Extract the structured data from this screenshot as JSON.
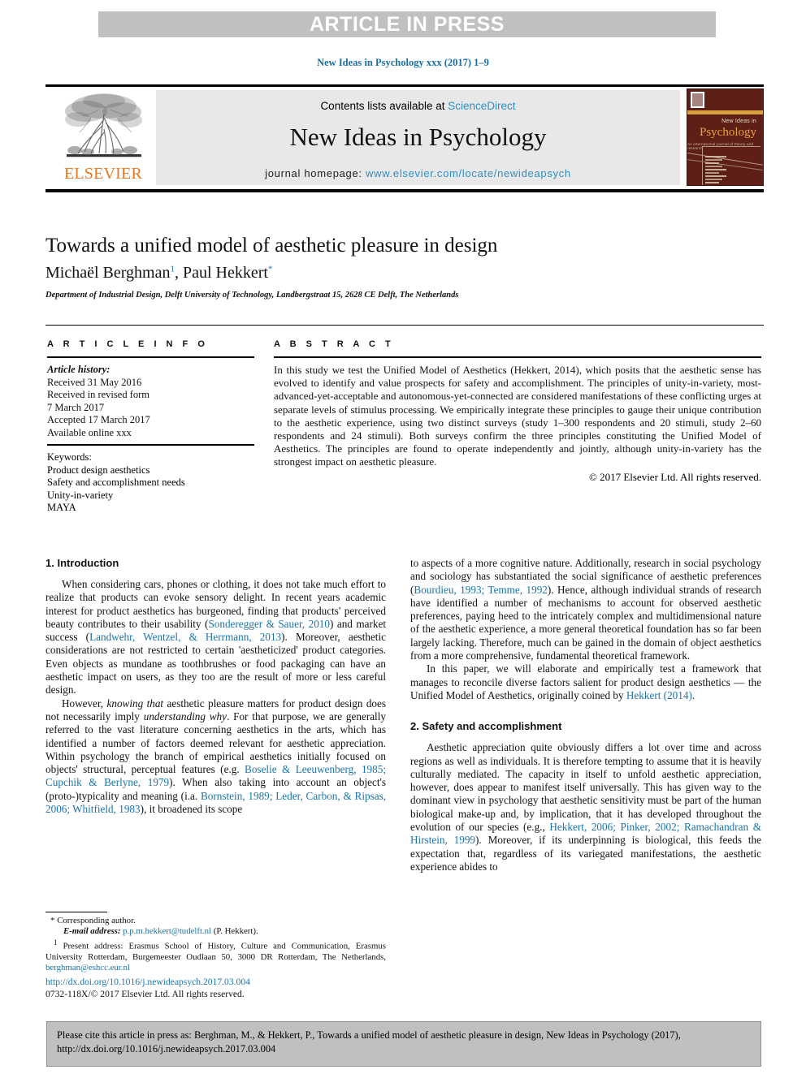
{
  "banner": {
    "label": "ARTICLE IN PRESS"
  },
  "running_head": {
    "text": "New Ideas in Psychology xxx (2017) 1–9"
  },
  "masthead": {
    "publisher_wordmark": "ELSEVIER",
    "contents_prefix": "Contents lists available at ",
    "contents_link": "ScienceDirect",
    "journal_name": "New Ideas in Psychology",
    "homepage_label": "journal homepage: ",
    "homepage_url": "www.elsevier.com/locate/newideapsych",
    "cover": {
      "line1": "New Ideas in",
      "line2": "Psychology",
      "line3": "An international journal of theory and research"
    }
  },
  "article": {
    "title": "Towards a unified model of aesthetic pleasure in design",
    "author1": "Michaël Berghman",
    "author1_sup": "1",
    "author_sep": ", ",
    "author2": "Paul Hekkert",
    "author2_sup": "*",
    "affiliation": "Department of Industrial Design, Delft University of Technology, Landbergstraat 15, 2628 CE Delft, The Netherlands"
  },
  "article_info": {
    "heading": "A R T I C L E   I N F O",
    "history_label": "Article history:",
    "history": [
      "Received 31 May 2016",
      "Received in revised form",
      "7 March 2017",
      "Accepted 17 March 2017",
      "Available online xxx"
    ],
    "keywords_label": "Keywords:",
    "keywords": [
      "Product design aesthetics",
      "Safety and accomplishment needs",
      "Unity-in-variety",
      "MAYA"
    ]
  },
  "abstract": {
    "heading": "A B S T R A C T",
    "text": "In this study we test the Unified Model of Aesthetics (Hekkert, 2014), which posits that the aesthetic sense has evolved to identify and value prospects for safety and accomplishment. The principles of unity-in-variety, most-advanced-yet-acceptable and autonomous-yet-connected are considered manifestations of these conflicting urges at separate levels of stimulus processing. We empirically integrate these principles to gauge their unique contribution to the aesthetic experience, using two distinct surveys (study 1–300 respondents and 20 stimuli, study 2–60 respondents and 24 stimuli). Both surveys confirm the three principles constituting the Unified Model of Aesthetics. The principles are found to operate independently and jointly, although unity-in-variety has the strongest impact on aesthetic pleasure.",
    "copyright": "© 2017 Elsevier Ltd. All rights reserved."
  },
  "sections": {
    "introduction_heading": "1. Introduction",
    "safety_heading": "2. Safety and accomplishment"
  },
  "body": {
    "left_p1_a": "When considering cars, phones or clothing, it does not take much effort to realize that products can evoke sensory delight. In recent years academic interest for product aesthetics has burgeoned, finding that products' perceived beauty contributes to their usability (",
    "left_p1_ref1": "Sonderegger & Sauer, 2010",
    "left_p1_b": ") and market success (",
    "left_p1_ref2": "Landwehr, Wentzel, & Herrmann, 2013",
    "left_p1_c": "). Moreover, aesthetic considerations are not restricted to certain 'aestheticized' product categories. Even objects as mundane as toothbrushes or food packaging can have an aesthetic impact on users, as they too are the result of more or less careful design.",
    "left_p2_a": "However, ",
    "left_p2_em1": "knowing that",
    "left_p2_b": " aesthetic pleasure matters for product design does not necessarily imply ",
    "left_p2_em2": "understanding why",
    "left_p2_c": ". For that purpose, we are generally referred to the vast literature concerning aesthetics in the arts, which has identified a number of factors deemed relevant for aesthetic appreciation. Within psychology the branch of empirical aesthetics initially focused on objects' structural, perceptual features (e.g. ",
    "left_p2_ref1": "Boselie & Leeuwenberg, 1985; Cupchik & Berlyne, 1979",
    "left_p2_d": "). When also taking into account an object's (proto-)typicality and meaning (i.a. ",
    "left_p2_ref2": "Bornstein, 1989; Leder, Carbon, & Ripsas, 2006; Whitfield, 1983",
    "left_p2_e": "), it broadened its scope",
    "right_p1_a": "to aspects of a more cognitive nature. Additionally, research in social psychology and sociology has substantiated the social significance of aesthetic preferences (",
    "right_p1_ref1": "Bourdieu, 1993; Temme, 1992",
    "right_p1_b": "). Hence, although individual strands of research have identified a number of mechanisms to account for observed aesthetic preferences, paying heed to the intricately complex and multidimensional nature of the aesthetic experience, a more general theoretical foundation has so far been largely lacking. Therefore, much can be gained in the domain of object aesthetics from a more comprehensive, fundamental theoretical framework.",
    "right_p2_a": "In this paper, we will elaborate and empirically test a framework that manages to reconcile diverse factors salient for product design aesthetics — the Unified Model of Aesthetics, originally coined by ",
    "right_p2_ref1": "Hekkert (2014)",
    "right_p2_b": ".",
    "right_p3_a": "Aesthetic appreciation quite obviously differs a lot over time and across regions as well as individuals. It is therefore tempting to assume that it is heavily culturally mediated. The capacity in itself to unfold aesthetic appreciation, however, does appear to manifest itself universally. This has given way to the dominant view in psychology that aesthetic sensitivity must be part of the human biological make-up and, by implication, that it has developed throughout the evolution of our species (e.g., ",
    "right_p3_ref1": "Hekkert, 2006; Pinker, 2002; Ramachandran & Hirstein, 1999",
    "right_p3_b": "). Moreover, if its underpinning is biological, this feeds the expectation that, regardless of its variegated manifestations, the aesthetic experience abides to"
  },
  "footnotes": {
    "star_symbol": "*",
    "corresponding": "Corresponding author.",
    "email_label": "E-mail address:",
    "email1": "p.p.m.hekkert@tudelft.nl",
    "email1_owner": "(P. Hekkert).",
    "fn1_marker": "1",
    "fn1_text": "Present address: Erasmus School of History, Culture and Communication, Erasmus University Rotterdam, Burgemeester Oudlaan 50, 3000 DR Rotterdam, The Netherlands, ",
    "fn1_email": "berghman@eshcc.eur.nl"
  },
  "doi_block": {
    "doi_url": "http://dx.doi.org/10.1016/j.newideapsych.2017.03.004",
    "issn_line": "0732-118X/© 2017 Elsevier Ltd. All rights reserved."
  },
  "citation_footer": {
    "text": "Please cite this article in press as: Berghman, M., & Hekkert, P., Towards a unified model of aesthetic pleasure in design, New Ideas in Psychology (2017), http://dx.doi.org/10.1016/j.newideapsych.2017.03.004"
  },
  "colors": {
    "link": "#1a74a8",
    "sciencedirect": "#2e8fc4",
    "elsevier_orange": "#e87722",
    "banner_bg": "#c0c0c0",
    "masthead_bg": "#e8e8e8",
    "cover_bg": "#5e1f16"
  }
}
